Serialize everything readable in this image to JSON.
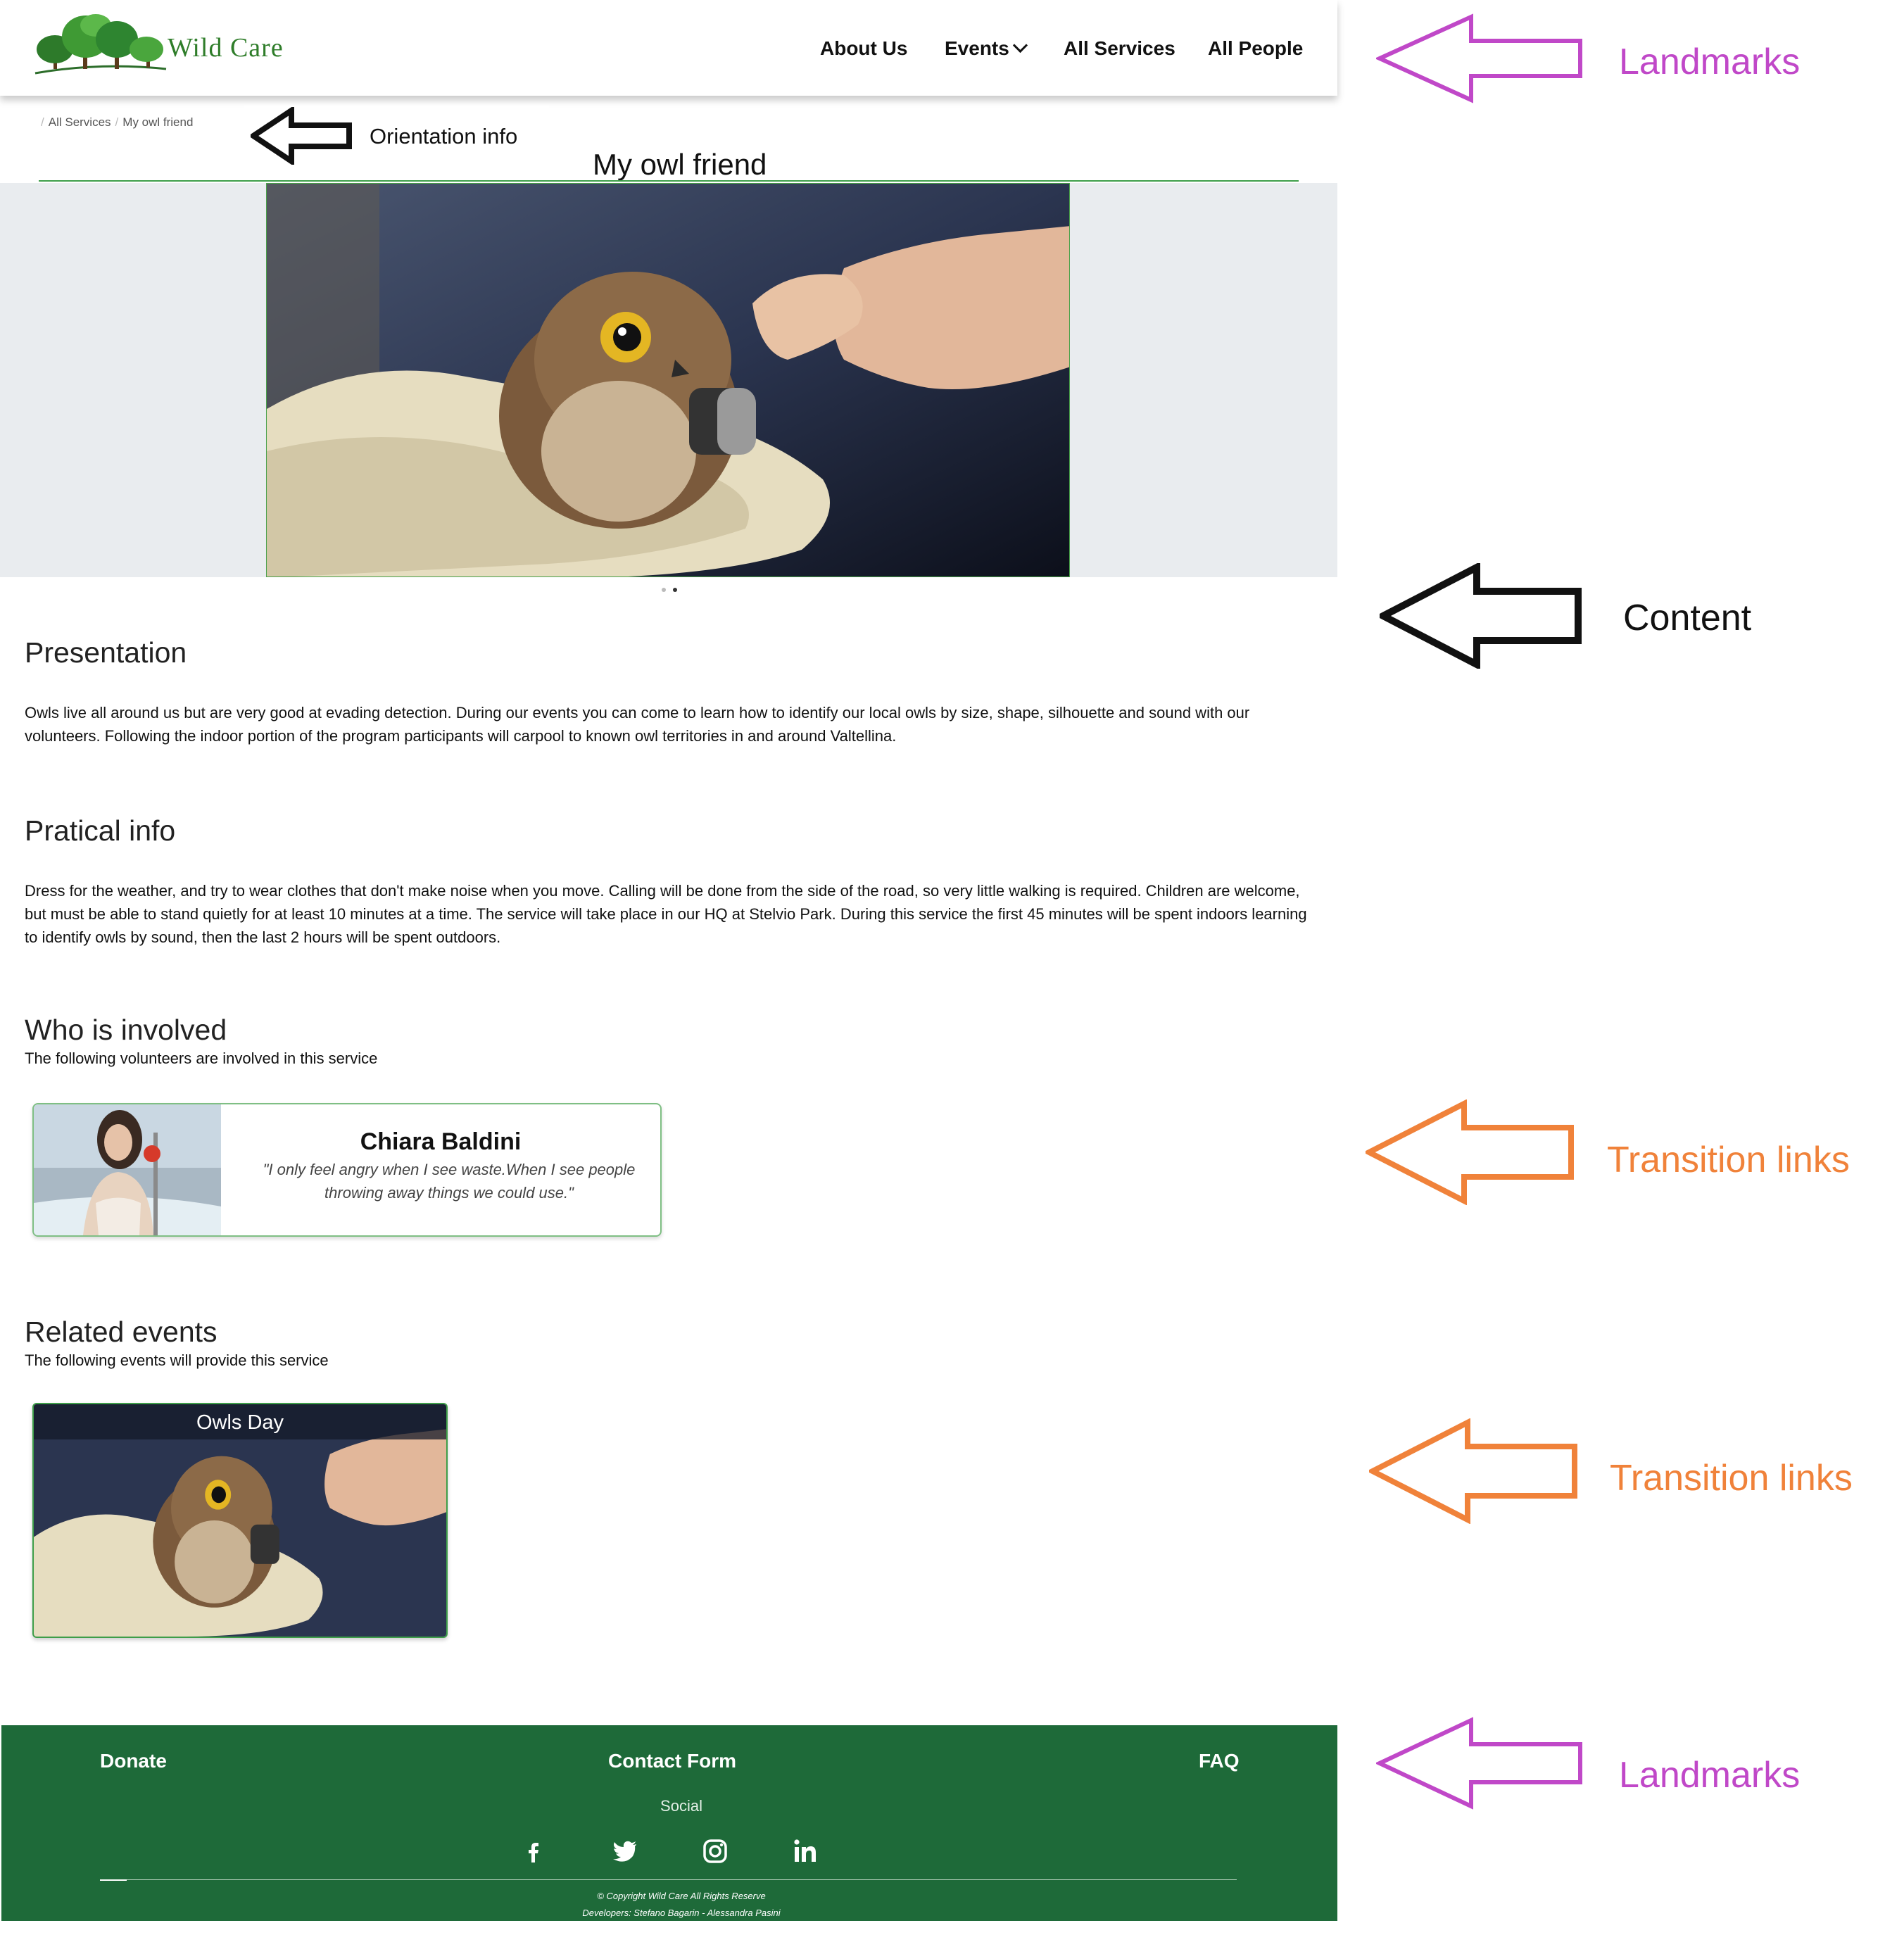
{
  "header": {
    "brand": "Wild Care",
    "nav": [
      {
        "label": "About Us"
      },
      {
        "label": "Events"
      },
      {
        "label": "All Services"
      },
      {
        "label": "All People"
      }
    ]
  },
  "breadcrumb": [
    "All Services",
    "My owl friend"
  ],
  "page_title": "My owl friend",
  "carousel": {
    "slides": 2,
    "active": 2
  },
  "sections": {
    "presentation": {
      "heading": "Presentation",
      "text": "Owls live all around us but are very good at evading detection. During our events you can come to learn how to identify our local owls by size, shape, silhouette and sound with our volunteers. Following the indoor portion of the program participants will carpool to known owl territories in and around Valtellina."
    },
    "practical": {
      "heading": "Pratical info",
      "text": "Dress for the weather, and try to wear clothes that don't make noise when you move. Calling will be done from the side of the road, so very little walking is required. Children are welcome, but must be able to stand quietly for at least 10 minutes at a time. The service will take place in our HQ at Stelvio Park. During this service the first 45 minutes will be spent indoors learning to identify owls by sound, then the last 2 hours will be spent outdoors."
    },
    "involved": {
      "heading": "Who is involved",
      "subtitle": "The following volunteers are involved in this service",
      "volunteer": {
        "name": "Chiara Baldini",
        "quote": "\"I only feel angry when I see waste.When I see people throwing away things we could use.\""
      }
    },
    "related": {
      "heading": "Related events",
      "subtitle": "The following events will provide this service",
      "event": {
        "title": "Owls Day"
      }
    }
  },
  "footer": {
    "links": [
      "Donate",
      "Contact Form",
      "FAQ"
    ],
    "social_label": "Social",
    "social_icons": [
      "facebook-icon",
      "twitter-icon",
      "instagram-icon",
      "linkedin-icon"
    ],
    "copyright": "© Copyright Wild Care All Rights Reserve",
    "developers": "Developers: Stefano Bagarin - Alessandra Pasini"
  },
  "annotations": {
    "landmarks_top": "Landmarks",
    "orientation": "Orientation info",
    "content": "Content",
    "transition_1": "Transition links",
    "transition_2": "Transition links",
    "landmarks_bottom": "Landmarks"
  },
  "colors": {
    "brand_green": "#2f7d2a",
    "footer_green": "#1e6a39",
    "landmark_arrow": "#c048c8",
    "transition_arrow": "#f0823a",
    "content_arrow": "#111111"
  }
}
